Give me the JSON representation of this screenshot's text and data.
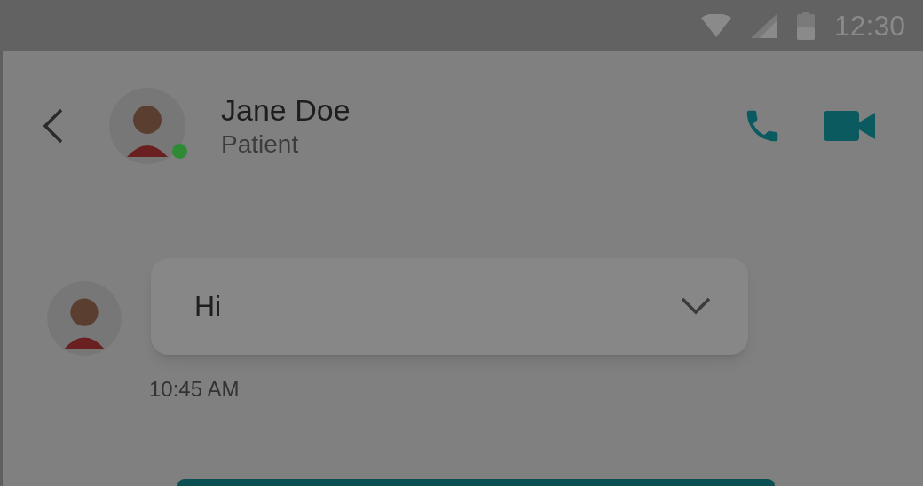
{
  "status_bar": {
    "time": "12:30"
  },
  "header": {
    "name": "Jane Doe",
    "subtitle": "Patient",
    "online": true
  },
  "messages": [
    {
      "text": "Hi",
      "time": "10:45 AM"
    }
  ]
}
